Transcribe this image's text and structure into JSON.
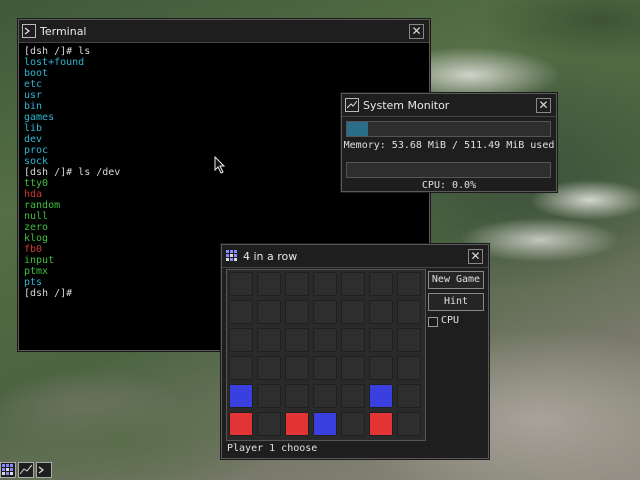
{
  "terminal": {
    "title": "Terminal",
    "lines": [
      {
        "text": "[dsh /]# ls",
        "color": "white"
      },
      {
        "text": "lost+found",
        "color": "cyan"
      },
      {
        "text": "boot",
        "color": "cyan"
      },
      {
        "text": "etc",
        "color": "cyan"
      },
      {
        "text": "usr",
        "color": "cyan"
      },
      {
        "text": "bin",
        "color": "cyan"
      },
      {
        "text": "games",
        "color": "cyan"
      },
      {
        "text": "lib",
        "color": "cyan"
      },
      {
        "text": "dev",
        "color": "cyan"
      },
      {
        "text": "proc",
        "color": "cyan"
      },
      {
        "text": "sock",
        "color": "cyan"
      },
      {
        "text": "[dsh /]# ls /dev",
        "color": "white"
      },
      {
        "text": "tty0",
        "color": "green"
      },
      {
        "text": "hda",
        "color": "red"
      },
      {
        "text": "random",
        "color": "green"
      },
      {
        "text": "null",
        "color": "green"
      },
      {
        "text": "zero",
        "color": "green"
      },
      {
        "text": "klog",
        "color": "green"
      },
      {
        "text": "fb0",
        "color": "red"
      },
      {
        "text": "input",
        "color": "green"
      },
      {
        "text": "ptmx",
        "color": "green"
      },
      {
        "text": "pts",
        "color": "cyan"
      },
      {
        "text": "[dsh /]#",
        "color": "white"
      }
    ]
  },
  "sysmon": {
    "title": "System Monitor",
    "memory_text": "Memory: 53.68 MiB / 511.49 MiB used",
    "memory_fraction": 0.105,
    "cpu_text": "CPU: 0.0%",
    "cpu_fraction": 0.0
  },
  "game": {
    "title": "4 in a row",
    "new_game_label": "New Game",
    "hint_label": "Hint",
    "cpu_label": "CPU",
    "cpu_checked": false,
    "status": "Player 1 choose",
    "board": [
      [
        0,
        0,
        0,
        0,
        0,
        0,
        0
      ],
      [
        0,
        0,
        0,
        0,
        0,
        0,
        0
      ],
      [
        0,
        0,
        0,
        0,
        0,
        0,
        0
      ],
      [
        0,
        0,
        0,
        0,
        0,
        0,
        0
      ],
      [
        2,
        0,
        0,
        0,
        0,
        2,
        0
      ],
      [
        1,
        0,
        1,
        2,
        0,
        1,
        0
      ]
    ]
  },
  "taskbar": {
    "items": [
      "game-icon",
      "sysmon-icon",
      "terminal-icon"
    ]
  },
  "colors": {
    "player1": "#e23434",
    "player2": "#3a40e0",
    "cyan": "#2fb5d4",
    "green": "#3fbf3f",
    "red": "#d03a3a"
  }
}
